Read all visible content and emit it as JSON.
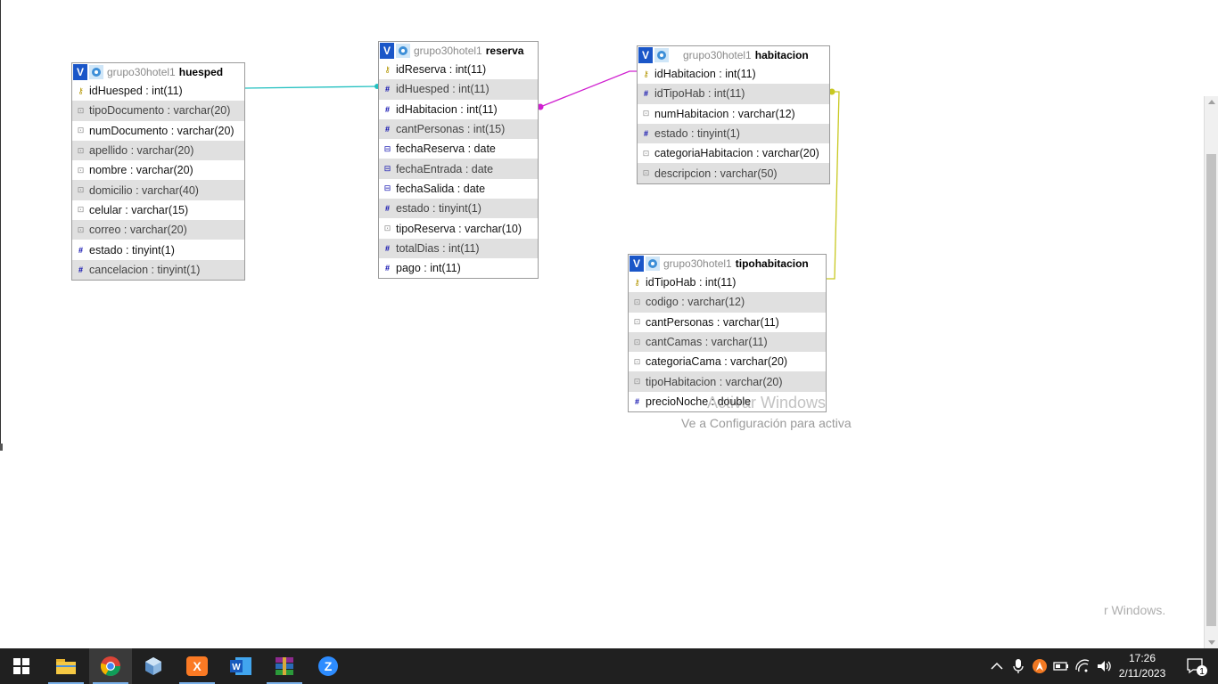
{
  "watermark": {
    "line1": "Activar Windows",
    "line2": "Ve a Configuración para activa",
    "line3": "r Windows."
  },
  "tables": {
    "huesped": {
      "db": "grupo30hotel1",
      "name": "huesped",
      "fields": [
        {
          "text": "idHuesped : int(11)",
          "type": "key"
        },
        {
          "text": "tipoDocumento : varchar(20)",
          "type": "str"
        },
        {
          "text": "numDocumento : varchar(20)",
          "type": "str"
        },
        {
          "text": "apellido : varchar(20)",
          "type": "str"
        },
        {
          "text": "nombre : varchar(20)",
          "type": "str"
        },
        {
          "text": "domicilio : varchar(40)",
          "type": "str"
        },
        {
          "text": "celular : varchar(15)",
          "type": "str"
        },
        {
          "text": "correo : varchar(20)",
          "type": "str"
        },
        {
          "text": "estado : tinyint(1)",
          "type": "num"
        },
        {
          "text": "cancelacion : tinyint(1)",
          "type": "num"
        }
      ]
    },
    "reserva": {
      "db": "grupo30hotel1",
      "name": "reserva",
      "fields": [
        {
          "text": "idReserva : int(11)",
          "type": "key"
        },
        {
          "text": "idHuesped : int(11)",
          "type": "num"
        },
        {
          "text": "idHabitacion : int(11)",
          "type": "num"
        },
        {
          "text": "cantPersonas : int(15)",
          "type": "num"
        },
        {
          "text": "fechaReserva : date",
          "type": "date"
        },
        {
          "text": "fechaEntrada : date",
          "type": "date"
        },
        {
          "text": "fechaSalida : date",
          "type": "date"
        },
        {
          "text": "estado : tinyint(1)",
          "type": "num"
        },
        {
          "text": "tipoReserva : varchar(10)",
          "type": "str"
        },
        {
          "text": "totalDias : int(11)",
          "type": "num"
        },
        {
          "text": "pago : int(11)",
          "type": "num"
        }
      ]
    },
    "habitacion": {
      "db": "grupo30hotel1",
      "name": "habitacion",
      "fields": [
        {
          "text": "idHabitacion : int(11)",
          "type": "key"
        },
        {
          "text": "idTipoHab : int(11)",
          "type": "num"
        },
        {
          "text": "numHabitacion : varchar(12)",
          "type": "str"
        },
        {
          "text": "estado : tinyint(1)",
          "type": "num"
        },
        {
          "text": "categoriaHabitacion : varchar(20)",
          "type": "str"
        },
        {
          "text": "descripcion : varchar(50)",
          "type": "str"
        }
      ]
    },
    "tipohabitacion": {
      "db": "grupo30hotel1",
      "name": "tipohabitacion",
      "fields": [
        {
          "text": "idTipoHab : int(11)",
          "type": "key"
        },
        {
          "text": "codigo : varchar(12)",
          "type": "str"
        },
        {
          "text": "cantPersonas : varchar(11)",
          "type": "str"
        },
        {
          "text": "cantCamas : varchar(11)",
          "type": "str"
        },
        {
          "text": "categoriaCama : varchar(20)",
          "type": "str"
        },
        {
          "text": "tipoHabitacion : varchar(20)",
          "type": "str"
        },
        {
          "text": "precioNoche : double",
          "type": "num"
        }
      ]
    }
  },
  "field_icons": {
    "key": "key-icon",
    "num": "hash-icon",
    "str": "string-icon",
    "date": "date-icon"
  },
  "relation_colors": {
    "huesped_reserva": "#22c0c0",
    "reserva_habitacion": "#d020d0",
    "habitacion_tipohabitacion": "#c8c820"
  },
  "taskbar": {
    "apps": [
      "start-icon",
      "file-explorer-icon",
      "chrome-icon",
      "virtualbox-icon",
      "xampp-icon",
      "word-icon",
      "winrar-icon",
      "zoom-icon"
    ],
    "time": "17:26",
    "date": "2/11/2023",
    "notification_count": "1"
  }
}
